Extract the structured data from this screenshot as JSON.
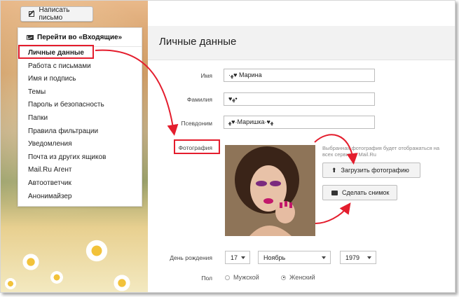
{
  "compose_button": {
    "label": "Написать письмо",
    "icon": "pen-icon"
  },
  "sidebar": {
    "inbox_link": "Перейти во «Входящие»",
    "items": [
      {
        "label": "Личные данные",
        "active": true
      },
      {
        "label": "Работа с письмами"
      },
      {
        "label": "Имя и подпись"
      },
      {
        "label": "Темы"
      },
      {
        "label": "Пароль и безопасность"
      },
      {
        "label": "Папки"
      },
      {
        "label": "Правила фильтрации"
      },
      {
        "label": "Уведомления"
      },
      {
        "label": "Почта из других ящиков"
      },
      {
        "label": "Mail.Ru Агент"
      },
      {
        "label": "Автоответчик"
      },
      {
        "label": "Анонимайзер"
      }
    ]
  },
  "page": {
    "title": "Личные данные"
  },
  "form": {
    "first_name_label": "Имя",
    "first_name_value": "·ﻬ♥ Марина",
    "last_name_label": "Фамилия",
    "last_name_value": "♥ﻬ•",
    "nickname_label": "Псевдоним",
    "nickname_value": "ﻬ♥·Маришка·♥ﻬ",
    "photo_label": "Фотография",
    "photo_hint": "Выбранная фотография будет отображаться на всех сервисах Mail.Ru",
    "upload_button": "Загрузить фотографию",
    "snapshot_button": "Сделать снимок",
    "birthday_label": "День рождения",
    "birthday_day": "17",
    "birthday_month": "Ноябрь",
    "birthday_year": "1979",
    "gender_label": "Пол",
    "gender_male": "Мужской",
    "gender_female": "Женский",
    "gender_selected": "female"
  },
  "colors": {
    "annotation": "#e41d2d",
    "header_bg": "#f2f2f2"
  }
}
